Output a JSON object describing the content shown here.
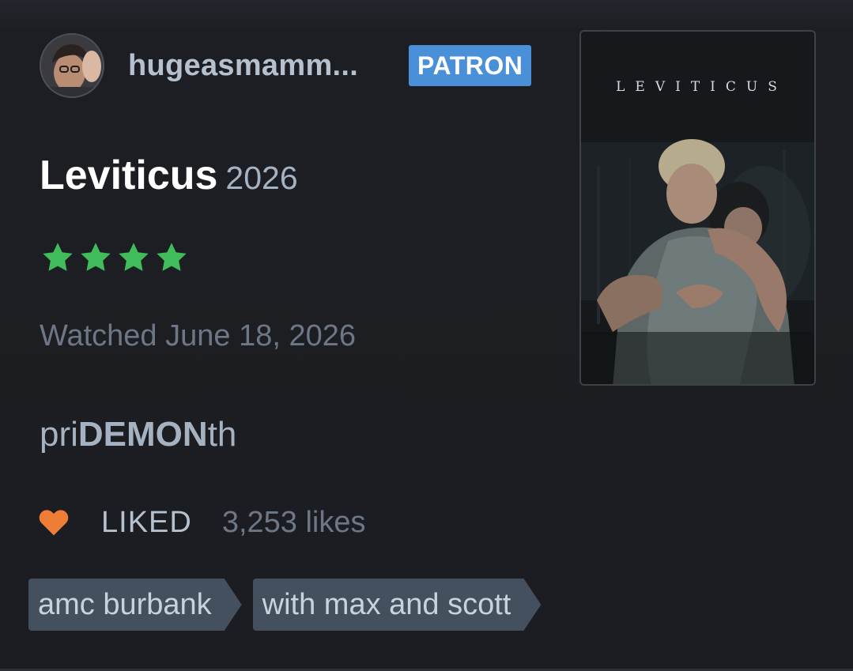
{
  "reviewer": {
    "username": "hugeasmamm...",
    "badge": "PATRON",
    "avatar_icon": "user-avatar"
  },
  "film": {
    "title": "Leviticus",
    "year": "2026",
    "rating_stars": 4,
    "rating_max": 5,
    "star_color": "#40bc5a",
    "poster_title": "LEVITICUS"
  },
  "watched": "Watched June 18, 2026",
  "review": {
    "prefix": "pri",
    "emphasis": "DEMON",
    "suffix": "th"
  },
  "like": {
    "icon": "heart-icon",
    "heart_color": "#ee7d35",
    "status": "LIKED",
    "count": "3,253 likes"
  },
  "tags": [
    {
      "label": "amc burbank"
    },
    {
      "label": "with max and scott"
    }
  ],
  "colors": {
    "background": "#1b1d22",
    "badge": "#4a90d9",
    "tag": "#44505e"
  }
}
